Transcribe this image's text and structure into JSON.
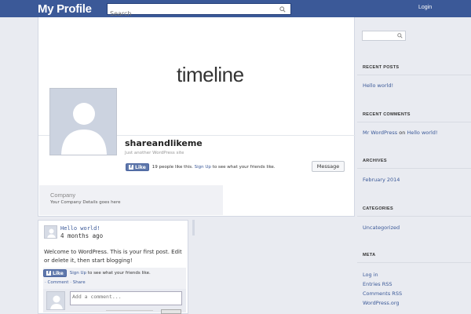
{
  "header": {
    "brand": "My Profile",
    "search_placeholder": "Search",
    "login_label": "Login"
  },
  "cover": {
    "title": "timeline"
  },
  "profile": {
    "name": "shareandlikeme",
    "tagline": "Just another WordPress site",
    "like_label": "Like",
    "like_count_text": "19 people like this.",
    "signup_link": "Sign Up",
    "signup_suffix": "to see what your friends like.",
    "message_button": "Message"
  },
  "company": {
    "title": "Company",
    "description": "Your Company Details goes here"
  },
  "post": {
    "title": "Hello world!",
    "date": "4 months ago",
    "body": "Welcome to WordPress. This is your first post. Edit or delete it, then start blogging!",
    "like_label": "Like",
    "signup_link": "Sign Up",
    "signup_suffix": "to see what your friends like.",
    "comment_label": "Comment",
    "share_label": "Share",
    "comment_placeholder": "Add a comment..."
  },
  "sidebar": {
    "recent_posts": {
      "heading": "RECENT POSTS",
      "items": [
        "Hello world!"
      ]
    },
    "recent_comments": {
      "heading": "RECENT COMMENTS",
      "author": "Mr WordPress",
      "on": "on",
      "post": "Hello world!"
    },
    "archives": {
      "heading": "ARCHIVES",
      "items": [
        "February 2014"
      ]
    },
    "categories": {
      "heading": "CATEGORIES",
      "items": [
        "Uncategorized"
      ]
    },
    "meta": {
      "heading": "META",
      "items": [
        "Log in",
        "Entries RSS",
        "Comments RSS",
        "WordPress.org"
      ]
    }
  },
  "colors": {
    "brand_blue": "#3b5998",
    "page_bg": "#e9ebf1"
  }
}
